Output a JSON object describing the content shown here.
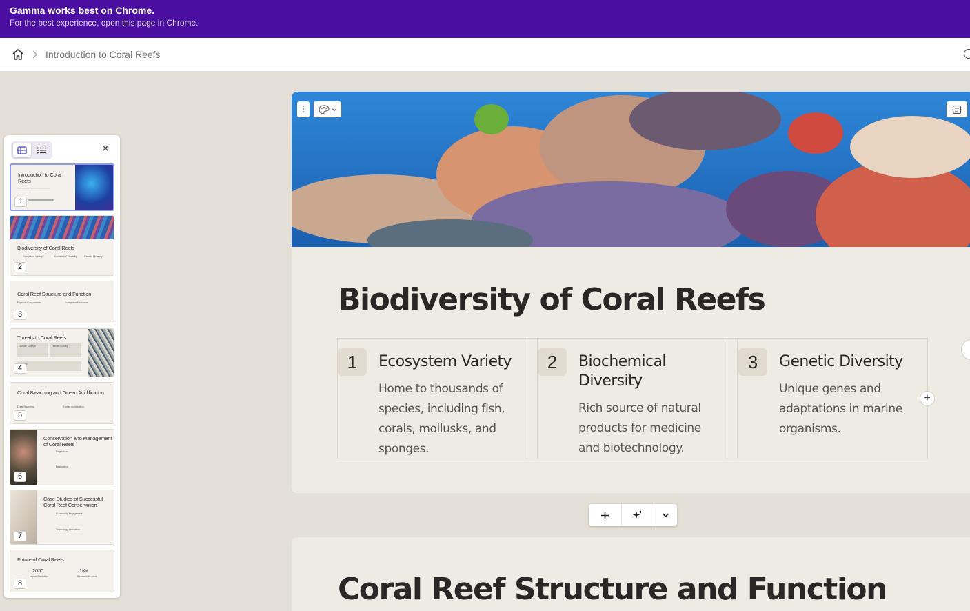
{
  "banner": {
    "title": "Gamma works best on Chrome.",
    "subtitle": "For the best experience, open this page in Chrome."
  },
  "topbar": {
    "breadcrumb": "Introduction to Coral Reefs",
    "home_icon": "home-icon"
  },
  "panel": {
    "thumbnails": [
      {
        "num": "1",
        "title": "Introduction to Coral Reefs"
      },
      {
        "num": "2",
        "title": "Biodiversity of Coral Reefs",
        "items": [
          "Ecosystem Variety",
          "Biochemical Diversity",
          "Genetic Diversity"
        ]
      },
      {
        "num": "3",
        "title": "Coral Reef Structure and Function",
        "items": [
          "Physical Components",
          "Ecosystem Functions"
        ]
      },
      {
        "num": "4",
        "title": "Threats to Coral Reefs",
        "items": [
          "Climate Change",
          "Human Activity",
          "Species"
        ]
      },
      {
        "num": "5",
        "title": "Coral Bleaching and Ocean Acidification",
        "items": [
          "Coral Bleaching",
          "Ocean Acidification"
        ]
      },
      {
        "num": "6",
        "title": "Conservation and Management of Coral Reefs",
        "items": [
          "Regulation",
          "Restoration"
        ]
      },
      {
        "num": "7",
        "title": "Case Studies of Successful Coral Reef Conservation",
        "items": [
          "Community Engagement",
          "Technology Innovation"
        ]
      },
      {
        "num": "8",
        "title": "Future of Coral Reefs",
        "stats": [
          "2050",
          "1K+"
        ],
        "stat_labels": [
          "Impact Prediction",
          "Research Projects"
        ]
      }
    ]
  },
  "card1": {
    "heading": "Biodiversity of Coral Reefs",
    "columns": [
      {
        "num": "1",
        "title": "Ecosystem Variety",
        "body": "Home to thousands of species, including fish, corals, mollusks, and sponges."
      },
      {
        "num": "2",
        "title": "Biochemical Diversity",
        "body": "Rich source of natural products for medicine and biotechnology."
      },
      {
        "num": "3",
        "title": "Genetic Diversity",
        "body": "Unique genes and adaptations in marine organisms."
      }
    ]
  },
  "card2": {
    "heading": "Coral Reef Structure and Function"
  }
}
